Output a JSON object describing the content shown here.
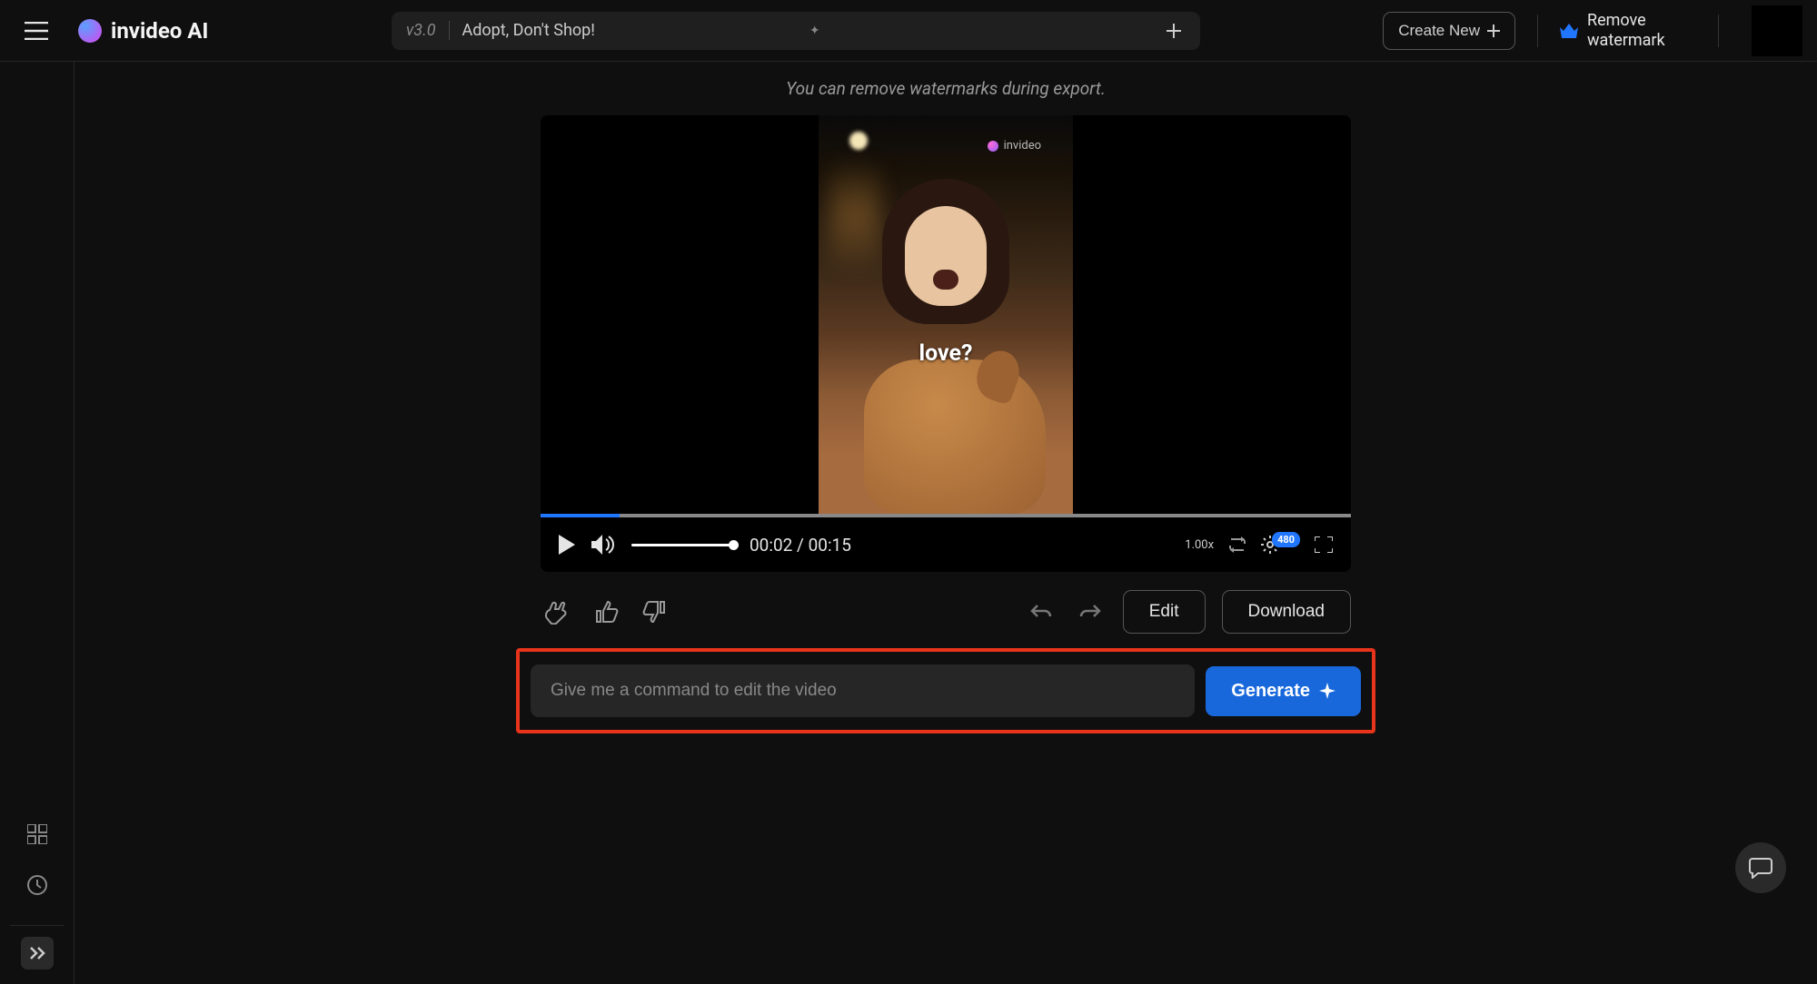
{
  "header": {
    "logo_text": "invideo AI",
    "version": "v3.0",
    "project_name": "Adopt, Don't Shop!",
    "create_new_label": "Create New",
    "remove_watermark_label": "Remove watermark"
  },
  "main": {
    "watermark_tip": "You can remove watermarks during export.",
    "caption": "love?",
    "watermark_brand": "invideo"
  },
  "player": {
    "current_time": "00:02",
    "total_time": "00:15",
    "speed": "1.00x",
    "quality": "480"
  },
  "actions": {
    "edit_label": "Edit",
    "download_label": "Download"
  },
  "prompt": {
    "placeholder": "Give me a command to edit the video",
    "generate_label": "Generate"
  }
}
